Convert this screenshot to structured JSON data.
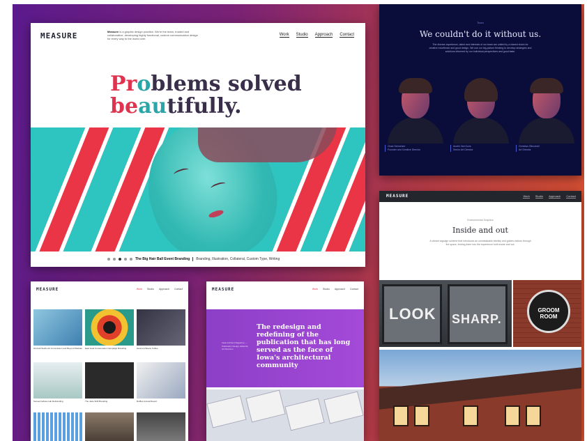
{
  "hero": {
    "logo": "MEASURE",
    "intro_bold": "Measure",
    "intro_text": " is a graphic design practice. We're the team, trusted and collaborative, developing highly functional, custom communication design for every way to the world over.",
    "nav": [
      "Work",
      "Studio",
      "Approach",
      "Contact"
    ],
    "headline_line1_a": "Pr",
    "headline_line1_b": "o",
    "headline_line1_c": "blems solved",
    "headline_line2_a": "be",
    "headline_line2_b": "au",
    "headline_line2_c": "tifully.",
    "caption_title": "The Big Hair Ball Event Branding",
    "caption_tags": "Branding, Illustration, Collateral, Custom Type, Writing",
    "carousel_dots": 5,
    "active_dot": 2
  },
  "thanks": {
    "tag": "Team",
    "title": "We couldn't do it without us.",
    "text": "The diverse experience, talent and interests of our team are united by a shared vision for creative excellence and good design. We use our big-picture thinking to develop strategies and solutions informed by our individual perspectives and good taste.",
    "people": [
      {
        "name": "Chad Schweizer",
        "role": "Founder and Creative Director"
      },
      {
        "name": "Austin Van Kuns",
        "role": "Senior Art Director"
      },
      {
        "name": "Christian Olbroeshi",
        "role": "Art Director"
      }
    ]
  },
  "inside": {
    "logo": "MEASURE",
    "nav": [
      "Work",
      "Studio",
      "Approach",
      "Contact"
    ],
    "tag": "Environmental Graphics",
    "title": "Inside and out",
    "text": "A vibrant signage scheme that introduces an unmistakable identity and guides visitors through the space, inviting them into the experience both inside and out.",
    "sign_word1": "LOOK",
    "sign_word2": "SHARP.",
    "badge_line1": "GROOM",
    "badge_line2": "ROOM"
  },
  "grid": {
    "logo": "MEASURE",
    "nav": [
      "Work",
      "Studio",
      "Approach",
      "Contact"
    ],
    "captions": [
      "Grinnell Studio Art Commission and Beyond Website",
      "East Iowa Conservation Campaign Branding",
      "Hanna & Beans Coffee",
      "Sunset Fellows Lab Rebranding",
      "The Jade Shift Branding",
      "Ruffles Annual Report"
    ]
  },
  "purple": {
    "logo": "MEASURE",
    "nav": [
      "Work",
      "Studio",
      "Approach",
      "Contact"
    ],
    "headline": "The redesign and redefining of the publication that has long served as the face of Iowa's architectural community",
    "side": "Iowa Architect Magazine — Publication Design, Editorial, Art Direction"
  }
}
